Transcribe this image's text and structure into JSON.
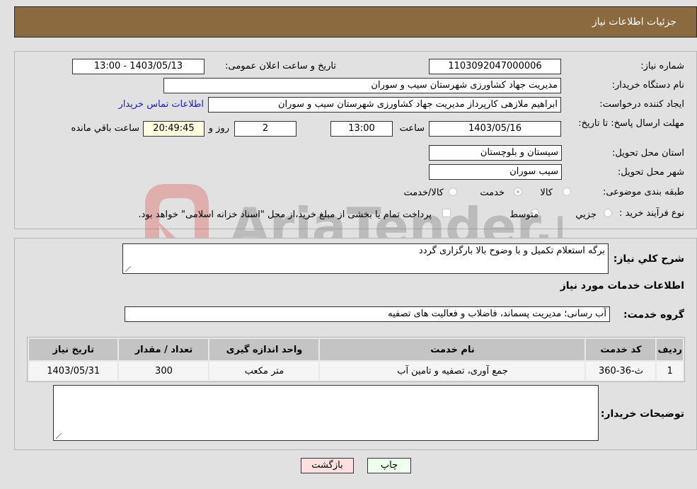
{
  "header": {
    "title": "جزئیات اطلاعات نیاز"
  },
  "fields": {
    "need_number": {
      "label": "شماره نیاز:",
      "value": "1103092047000006"
    },
    "announce_datetime": {
      "label": "تاریخ و ساعت اعلان عمومی:",
      "value": "1403/05/13 - 13:00"
    },
    "buyer_org": {
      "label": "نام دستگاه خریدار:",
      "value": "مدیریت جهاد کشاورزی شهرستان سیب و سوران"
    },
    "requester": {
      "label": "ایجاد کننده درخواست:",
      "value": "ابراهیم ملازهی کارپرداز مدیریت جهاد کشاورزی شهرستان سیب و سوران"
    },
    "contact_link": "اطلاعات تماس خریدار",
    "deadline": {
      "label": "مهلت ارسال پاسخ: تا تاریخ:",
      "date": "1403/05/16",
      "time_label": "ساعت",
      "time": "13:00",
      "days": "2",
      "days_label": "روز و",
      "remaining": "20:49:45",
      "remaining_label": "ساعت باقي مانده"
    },
    "province": {
      "label": "استان محل تحویل:",
      "value": "سیستان و بلوچستان"
    },
    "city": {
      "label": "شهر محل تحویل:",
      "value": "سیب سوران"
    },
    "category": {
      "label": "طبقه بندی موضوعی:",
      "options": [
        "کالا",
        "خدمت",
        "کالا/خدمت"
      ],
      "selected": "خدمت"
    },
    "purchase_type": {
      "label": "نوع فرآیند خرید :",
      "options": [
        "جزیي",
        "متوسط"
      ],
      "note": "پرداخت تمام یا بخشی از مبلغ خرید،از محل \"اسناد خزانه اسلامی\" خواهد بود."
    }
  },
  "description": {
    "label": "شرح کلي نیاز:",
    "value": "برگه استعلام تکمیل و با وضوح بالا بارگزاری گردد"
  },
  "services_section": {
    "title": "اطلاعات خدمات مورد نیاز",
    "group_label": "گروه خدمت:",
    "group_value": "آب رسانی؛ مدیریت پسماند، فاضلاب و فعالیت های تصفیه"
  },
  "table": {
    "headers": [
      "ردیف",
      "کد خدمت",
      "نام خدمت",
      "واحد اندازه گیری",
      "تعداد / مقدار",
      "تاریخ نیاز"
    ],
    "rows": [
      [
        "1",
        "ث-36-360",
        "جمع آوری، تصفیه و تامین آب",
        "متر مکعب",
        "300",
        "1403/05/31"
      ]
    ]
  },
  "buyer_notes": {
    "label": "توضیحات خریدار:",
    "value": ""
  },
  "buttons": {
    "print": "چاپ",
    "back": "بازگشت"
  },
  "colors": {
    "header_bg": "#8b6a40",
    "print_bg": "#eeffee",
    "back_bg": "#ffe0e0"
  },
  "watermark": "AriaTender.neT"
}
